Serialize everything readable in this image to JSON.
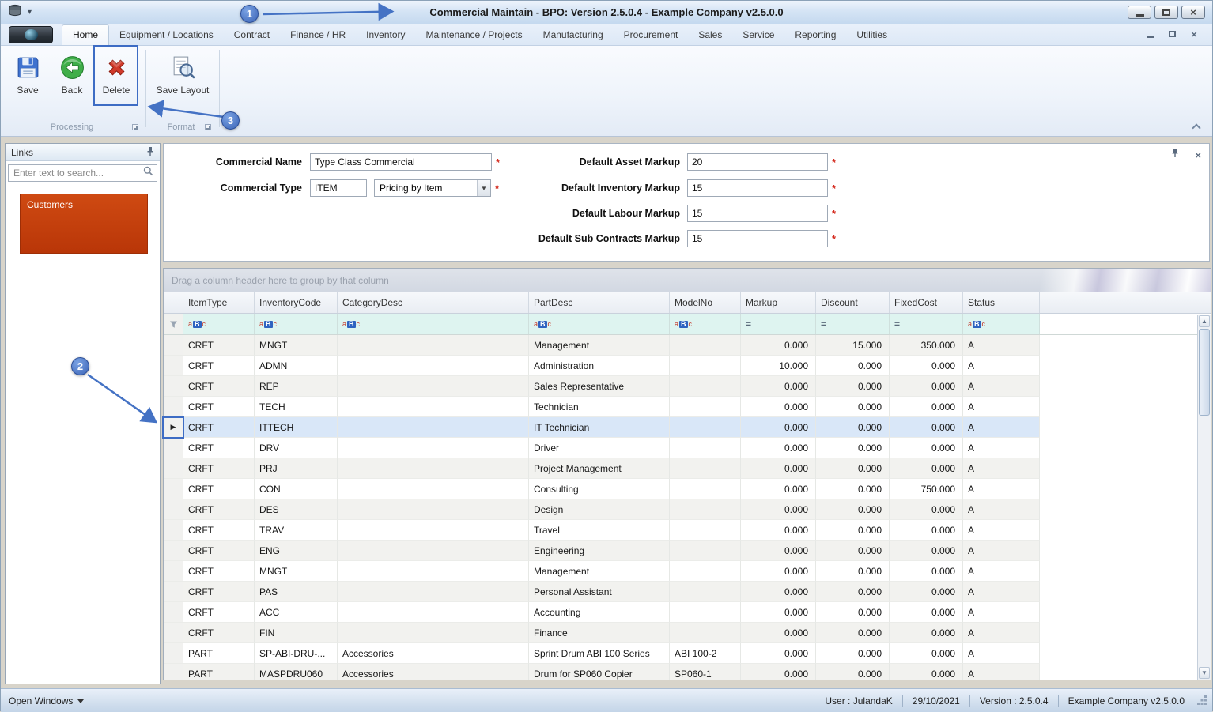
{
  "titlebar": {
    "title": "Commercial Maintain - BPO: Version 2.5.0.4 - Example Company v2.5.0.0"
  },
  "ribbon": {
    "tabs": [
      "Home",
      "Equipment / Locations",
      "Contract",
      "Finance / HR",
      "Inventory",
      "Maintenance / Projects",
      "Manufacturing",
      "Procurement",
      "Sales",
      "Service",
      "Reporting",
      "Utilities"
    ],
    "active_tab": 0,
    "buttons": {
      "save": "Save",
      "back": "Back",
      "delete": "Delete",
      "save_layout": "Save Layout"
    },
    "groups": {
      "processing": "Processing",
      "format": "Format"
    }
  },
  "links_panel": {
    "title": "Links",
    "search_placeholder": "Enter text to search...",
    "tile": "Customers"
  },
  "form": {
    "required_marker": "*",
    "commercial_name": {
      "label": "Commercial Name",
      "value": "Type Class Commercial"
    },
    "commercial_type": {
      "label": "Commercial Type",
      "value": "ITEM",
      "pricing": "Pricing by Item"
    },
    "default_asset_markup": {
      "label": "Default Asset Markup",
      "value": "20"
    },
    "default_inventory_markup": {
      "label": "Default Inventory Markup",
      "value": "15"
    },
    "default_labour_markup": {
      "label": "Default Labour Markup",
      "value": "15"
    },
    "default_sub_contracts_markup": {
      "label": "Default Sub Contracts Markup",
      "value": "15"
    }
  },
  "grid": {
    "group_hint": "Drag a column header here to group by that column",
    "filter_icon_abc": [
      "a",
      "B",
      "c"
    ],
    "filter_icon_equals": "=",
    "columns": [
      {
        "label": "ItemType",
        "filter": "abc"
      },
      {
        "label": "InventoryCode",
        "filter": "abc"
      },
      {
        "label": "CategoryDesc",
        "filter": "abc"
      },
      {
        "label": "PartDesc",
        "filter": "abc"
      },
      {
        "label": "ModelNo",
        "filter": "abc"
      },
      {
        "label": "Markup",
        "filter": "="
      },
      {
        "label": "Discount",
        "filter": "="
      },
      {
        "label": "FixedCost",
        "filter": "="
      },
      {
        "label": "Status",
        "filter": "abc"
      }
    ],
    "selected_row": 4,
    "rows": [
      [
        "CRFT",
        "MNGT",
        "",
        "Management",
        "",
        "0.000",
        "15.000",
        "350.000",
        "A"
      ],
      [
        "CRFT",
        "ADMN",
        "",
        "Administration",
        "",
        "10.000",
        "0.000",
        "0.000",
        "A"
      ],
      [
        "CRFT",
        "REP",
        "",
        "Sales Representative",
        "",
        "0.000",
        "0.000",
        "0.000",
        "A"
      ],
      [
        "CRFT",
        "TECH",
        "",
        "Technician",
        "",
        "0.000",
        "0.000",
        "0.000",
        "A"
      ],
      [
        "CRFT",
        "ITTECH",
        "",
        "IT Technician",
        "",
        "0.000",
        "0.000",
        "0.000",
        "A"
      ],
      [
        "CRFT",
        "DRV",
        "",
        "Driver",
        "",
        "0.000",
        "0.000",
        "0.000",
        "A"
      ],
      [
        "CRFT",
        "PRJ",
        "",
        "Project Management",
        "",
        "0.000",
        "0.000",
        "0.000",
        "A"
      ],
      [
        "CRFT",
        "CON",
        "",
        "Consulting",
        "",
        "0.000",
        "0.000",
        "750.000",
        "A"
      ],
      [
        "CRFT",
        "DES",
        "",
        "Design",
        "",
        "0.000",
        "0.000",
        "0.000",
        "A"
      ],
      [
        "CRFT",
        "TRAV",
        "",
        "Travel",
        "",
        "0.000",
        "0.000",
        "0.000",
        "A"
      ],
      [
        "CRFT",
        "ENG",
        "",
        "Engineering",
        "",
        "0.000",
        "0.000",
        "0.000",
        "A"
      ],
      [
        "CRFT",
        "MNGT",
        "",
        "Management",
        "",
        "0.000",
        "0.000",
        "0.000",
        "A"
      ],
      [
        "CRFT",
        "PAS",
        "",
        "Personal Assistant",
        "",
        "0.000",
        "0.000",
        "0.000",
        "A"
      ],
      [
        "CRFT",
        "ACC",
        "",
        "Accounting",
        "",
        "0.000",
        "0.000",
        "0.000",
        "A"
      ],
      [
        "CRFT",
        "FIN",
        "",
        "Finance",
        "",
        "0.000",
        "0.000",
        "0.000",
        "A"
      ],
      [
        "PART",
        "SP-ABI-DRU-...",
        "Accessories",
        "Sprint Drum ABI 100 Series",
        "ABI 100-2",
        "0.000",
        "0.000",
        "0.000",
        "A"
      ],
      [
        "PART",
        "MASPDRU060",
        "Accessories",
        "Drum for SP060 Copier",
        "SP060-1",
        "0.000",
        "0.000",
        "0.000",
        "A"
      ]
    ]
  },
  "statusbar": {
    "open_windows": "Open Windows",
    "items": [
      "User : JulandaK",
      "29/10/2021",
      "Version : 2.5.0.4",
      "Example Company v2.5.0.0"
    ]
  },
  "callouts": [
    "1",
    "2",
    "3"
  ]
}
